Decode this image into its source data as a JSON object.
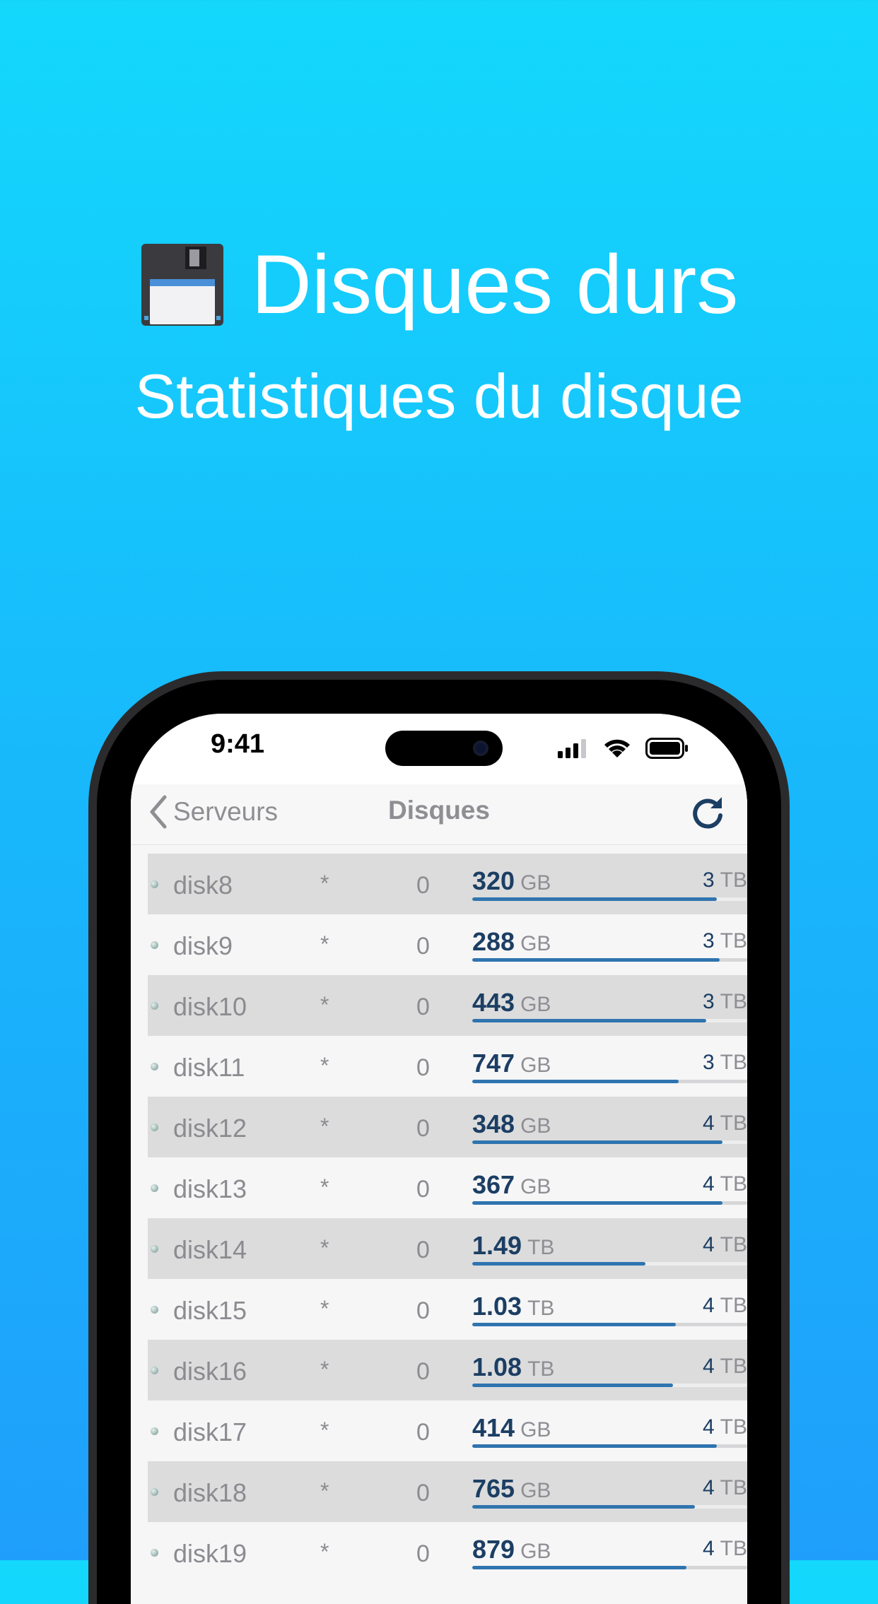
{
  "hero": {
    "title": "Disques durs",
    "subtitle": "Statistiques du disque",
    "icon": "floppy-disk-icon"
  },
  "status_bar": {
    "time": "9:41",
    "icons": [
      "cellular-signal-icon",
      "wifi-icon",
      "battery-icon"
    ]
  },
  "nav": {
    "back_label": "Serveurs",
    "title": "Disques",
    "refresh_icon": "refresh-icon"
  },
  "colors": {
    "accent": "#2f74af",
    "value_text": "#1c3e63",
    "muted_text": "#8e8e93",
    "row_shaded": "#dcdcdd",
    "row_plain": "#f6f6f7"
  },
  "disks": [
    {
      "name": "disk8",
      "flag": "*",
      "count": "0",
      "used_value": "320",
      "used_unit": "GB",
      "total_value": "3",
      "total_unit": "TB",
      "usage": 0.89
    },
    {
      "name": "disk9",
      "flag": "*",
      "count": "0",
      "used_value": "288",
      "used_unit": "GB",
      "total_value": "3",
      "total_unit": "TB",
      "usage": 0.9
    },
    {
      "name": "disk10",
      "flag": "*",
      "count": "0",
      "used_value": "443",
      "used_unit": "GB",
      "total_value": "3",
      "total_unit": "TB",
      "usage": 0.85
    },
    {
      "name": "disk11",
      "flag": "*",
      "count": "0",
      "used_value": "747",
      "used_unit": "GB",
      "total_value": "3",
      "total_unit": "TB",
      "usage": 0.75
    },
    {
      "name": "disk12",
      "flag": "*",
      "count": "0",
      "used_value": "348",
      "used_unit": "GB",
      "total_value": "4",
      "total_unit": "TB",
      "usage": 0.91
    },
    {
      "name": "disk13",
      "flag": "*",
      "count": "0",
      "used_value": "367",
      "used_unit": "GB",
      "total_value": "4",
      "total_unit": "TB",
      "usage": 0.91
    },
    {
      "name": "disk14",
      "flag": "*",
      "count": "0",
      "used_value": "1.49",
      "used_unit": "TB",
      "total_value": "4",
      "total_unit": "TB",
      "usage": 0.63
    },
    {
      "name": "disk15",
      "flag": "*",
      "count": "0",
      "used_value": "1.03",
      "used_unit": "TB",
      "total_value": "4",
      "total_unit": "TB",
      "usage": 0.74
    },
    {
      "name": "disk16",
      "flag": "*",
      "count": "0",
      "used_value": "1.08",
      "used_unit": "TB",
      "total_value": "4",
      "total_unit": "TB",
      "usage": 0.73
    },
    {
      "name": "disk17",
      "flag": "*",
      "count": "0",
      "used_value": "414",
      "used_unit": "GB",
      "total_value": "4",
      "total_unit": "TB",
      "usage": 0.89
    },
    {
      "name": "disk18",
      "flag": "*",
      "count": "0",
      "used_value": "765",
      "used_unit": "GB",
      "total_value": "4",
      "total_unit": "TB",
      "usage": 0.81
    },
    {
      "name": "disk19",
      "flag": "*",
      "count": "0",
      "used_value": "879",
      "used_unit": "GB",
      "total_value": "4",
      "total_unit": "TB",
      "usage": 0.78
    }
  ]
}
